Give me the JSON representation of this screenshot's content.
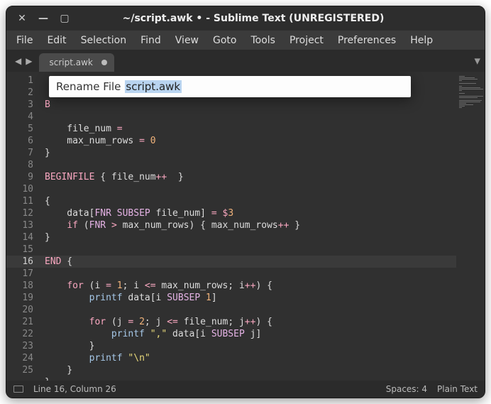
{
  "titlebar": {
    "title": "~/script.awk • - Sublime Text (UNREGISTERED)"
  },
  "menu": {
    "file": "File",
    "edit": "Edit",
    "selection": "Selection",
    "find": "Find",
    "view": "View",
    "goto": "Goto",
    "tools": "Tools",
    "project": "Project",
    "preferences": "Preferences",
    "help": "Help"
  },
  "tab": {
    "name": "script.awk"
  },
  "overlay": {
    "label": "Rename File",
    "value": "script.awk"
  },
  "gutter": {
    "lines": [
      "1",
      "2",
      "3",
      "4",
      "5",
      "6",
      "7",
      "8",
      "9",
      "10",
      "11",
      "12",
      "13",
      "14",
      "15",
      "16",
      "17",
      "18",
      "19",
      "20",
      "21",
      "22",
      "23",
      "24",
      "25"
    ],
    "highlighted": "16"
  },
  "code": {
    "l1a": "B",
    "l2_indent": "    ",
    "l3a": "    file_num ",
    "l3b": "=",
    "l4a": "    max_num_rows ",
    "l4b": "=",
    "l4c": " ",
    "l4d": "0",
    "l5": "}",
    "l6": "",
    "l7a": "BEGINFILE",
    "l7b": " { file_num",
    "l7c": "++",
    "l7d": "  }",
    "l8": "",
    "l9": "{",
    "l10a": "    data[",
    "l10b": "FNR",
    "l10c": " ",
    "l10d": "SUBSEP",
    "l10e": " file_num] ",
    "l10f": "=",
    "l10g": " ",
    "l10h": "$",
    "l10i": "3",
    "l11a": "    ",
    "l11b": "if",
    "l11c": " (",
    "l11d": "FNR",
    "l11e": " ",
    "l11f": ">",
    "l11g": " max_num_rows) { max_num_rows",
    "l11h": "++",
    "l11i": " }",
    "l12": "}",
    "l13": "",
    "l14a": "END",
    "l14b": " {",
    "l15": "",
    "l16a": "    ",
    "l16b": "for",
    "l16c": " (i ",
    "l16d": "=",
    "l16e": " ",
    "l16f": "1",
    "l16g": "; i ",
    "l16h": "<=",
    "l16i": " max_num_rows; i",
    "l16j": "++",
    "l16k": ") {",
    "l17a": "        ",
    "l17b": "printf",
    "l17c": " data[i ",
    "l17d": "SUBSEP",
    "l17e": " ",
    "l17f": "1",
    "l17g": "]",
    "l18": "",
    "l19a": "        ",
    "l19b": "for",
    "l19c": " (j ",
    "l19d": "=",
    "l19e": " ",
    "l19f": "2",
    "l19g": "; j ",
    "l19h": "<=",
    "l19i": " file_num; j",
    "l19j": "++",
    "l19k": ") {",
    "l20a": "            ",
    "l20b": "printf",
    "l20c": " ",
    "l20d": "\",\"",
    "l20e": " data[i ",
    "l20f": "SUBSEP",
    "l20g": " j]",
    "l21": "        }",
    "l22a": "        ",
    "l22b": "printf",
    "l22c": " ",
    "l22d": "\"\\n\"",
    "l23": "    }",
    "l24": "}",
    "l25": ""
  },
  "statusbar": {
    "position": "Line 16, Column 26",
    "spaces": "Spaces: 4",
    "syntax": "Plain Text"
  }
}
